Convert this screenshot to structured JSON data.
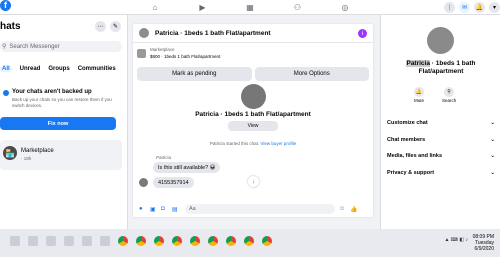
{
  "topbar": {
    "logo": "f",
    "nav_icons": [
      "home-icon",
      "watch-icon",
      "marketplace-icon",
      "groups-icon",
      "gaming-icon"
    ]
  },
  "left": {
    "title": "hats",
    "search_placeholder": "Search Messenger",
    "filters": [
      "All",
      "Unread",
      "Groups",
      "Communities"
    ],
    "backup": {
      "title": "Your chats aren't backed up",
      "desc": "Back up your chats so you can restore them if you switch devices.",
      "button": "Fix now"
    },
    "conversation": {
      "name": "Marketplace",
      "meta": "· 19h"
    }
  },
  "chat": {
    "title": "Patricia · 1beds 1 bath Flat/apartment",
    "marketplace_label": "Marketplace",
    "listing": "$800 · 1beds 1 bath Flat/apartment",
    "action_pending": "Mark as pending",
    "action_more": "More Options",
    "hero_title": "Patricia · 1beds 1 bath Flat/apartment",
    "view": "View",
    "started_text": "Patricia started this chat.",
    "started_link": "View buyer profile",
    "sender": "Patricia",
    "msg1": "Is this still available? 😀",
    "msg2": "4155357914",
    "composer_placeholder": "Aa"
  },
  "right": {
    "title_prefix": "Patricia",
    "title_rest": " · 1beds 1 bath Flat/apartment",
    "mute": "Mute",
    "search": "Search",
    "sections": [
      "Customize chat",
      "Chat members",
      "Media, files and links",
      "Privacy & support"
    ]
  },
  "taskbar": {
    "time": "08:09 PM",
    "day": "Tuesday",
    "date": "6/9/2020"
  }
}
